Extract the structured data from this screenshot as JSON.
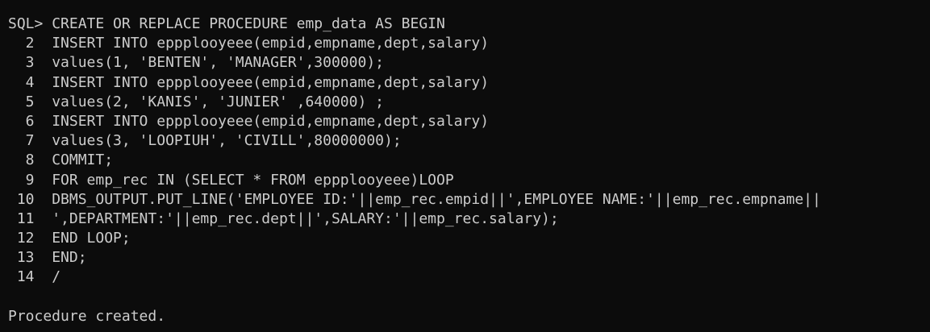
{
  "terminal": {
    "background": "#0c0c0c",
    "foreground": "#cccccc",
    "prompt": "SQL> ",
    "first_line": "CREATE OR REPLACE PROCEDURE emp_data AS BEGIN",
    "lines": [
      {
        "num": "  2  ",
        "text": "INSERT INTO eppplooyeee(empid,empname,dept,salary)"
      },
      {
        "num": "  3  ",
        "text": "values(1, 'BENTEN', 'MANAGER',300000);"
      },
      {
        "num": "  4  ",
        "text": "INSERT INTO eppplooyeee(empid,empname,dept,salary)"
      },
      {
        "num": "  5  ",
        "text": "values(2, 'KANIS', 'JUNIER' ,640000) ;"
      },
      {
        "num": "  6  ",
        "text": "INSERT INTO eppplooyeee(empid,empname,dept,salary)"
      },
      {
        "num": "  7  ",
        "text": "values(3, 'LOOPIUH', 'CIVILL',80000000);"
      },
      {
        "num": "  8  ",
        "text": "COMMIT;"
      },
      {
        "num": "  9  ",
        "text": "FOR emp_rec IN (SELECT * FROM eppplooyeee)LOOP"
      },
      {
        "num": " 10  ",
        "text": "DBMS_OUTPUT.PUT_LINE('EMPLOYEE ID:'||emp_rec.empid||',EMPLOYEE NAME:'||emp_rec.empname||"
      },
      {
        "num": " 11  ",
        "text": "',DEPARTMENT:'||emp_rec.dept||',SALARY:'||emp_rec.salary);"
      },
      {
        "num": " 12  ",
        "text": "END LOOP;"
      },
      {
        "num": " 13  ",
        "text": "END;"
      },
      {
        "num": " 14  ",
        "text": "/"
      }
    ],
    "result": "Procedure created."
  }
}
